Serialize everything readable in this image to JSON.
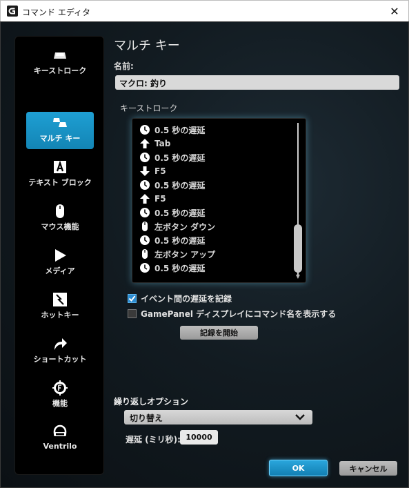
{
  "window": {
    "title": "コマンド エディタ",
    "close_label": "✕"
  },
  "sidebar": {
    "items": [
      {
        "label": "キーストローク",
        "icon": "keystroke-icon"
      },
      {
        "label": "マルチ キー",
        "icon": "multikey-icon",
        "active": true
      },
      {
        "label": "テキスト ブロック",
        "icon": "text-block-icon"
      },
      {
        "label": "マウス機能",
        "icon": "mouse-icon"
      },
      {
        "label": "メディア",
        "icon": "play-icon"
      },
      {
        "label": "ホットキー",
        "icon": "hotkey-icon"
      },
      {
        "label": "ショートカット",
        "icon": "shortcut-arrow-icon"
      },
      {
        "label": "機能",
        "icon": "function-gear-icon"
      },
      {
        "label": "Ventrilo",
        "icon": "headset-icon"
      }
    ]
  },
  "main": {
    "title": "マルチ キー",
    "name_label": "名前:",
    "name_value": "マクロ: 釣り",
    "keystroke_label": "キーストローク",
    "keystrokes": [
      {
        "icon": "clock-icon",
        "text": "0.5 秒の遅延"
      },
      {
        "icon": "arrow-up-icon",
        "text": "Tab"
      },
      {
        "icon": "clock-icon",
        "text": "0.5 秒の遅延"
      },
      {
        "icon": "arrow-down-icon",
        "text": "F5"
      },
      {
        "icon": "clock-icon",
        "text": "0.5 秒の遅延"
      },
      {
        "icon": "arrow-up-icon",
        "text": "F5"
      },
      {
        "icon": "clock-icon",
        "text": "0.5 秒の遅延"
      },
      {
        "icon": "mouse-icon",
        "text": "左ボタン ダウン"
      },
      {
        "icon": "clock-icon",
        "text": "0.5 秒の遅延"
      },
      {
        "icon": "mouse-icon",
        "text": "左ボタン アップ"
      },
      {
        "icon": "clock-icon",
        "text": "0.5 秒の遅延"
      }
    ],
    "record_delay_label": "イベント間の遅延を記録",
    "record_delay_checked": true,
    "gamepanel_label": "GamePanel ディスプレイにコマンド名を表示する",
    "gamepanel_checked": false,
    "start_record_label": "記録を開始",
    "repeat_label": "繰り返しオプション",
    "repeat_value": "切り替え",
    "delay_label": "遅延 (ミリ秒):",
    "delay_value": "10000",
    "ok_label": "OK",
    "cancel_label": "キャンセル"
  },
  "colors": {
    "accent": "#1e9fd3",
    "sidebar_bg": "#000000",
    "panel_bg": "#121b21"
  }
}
